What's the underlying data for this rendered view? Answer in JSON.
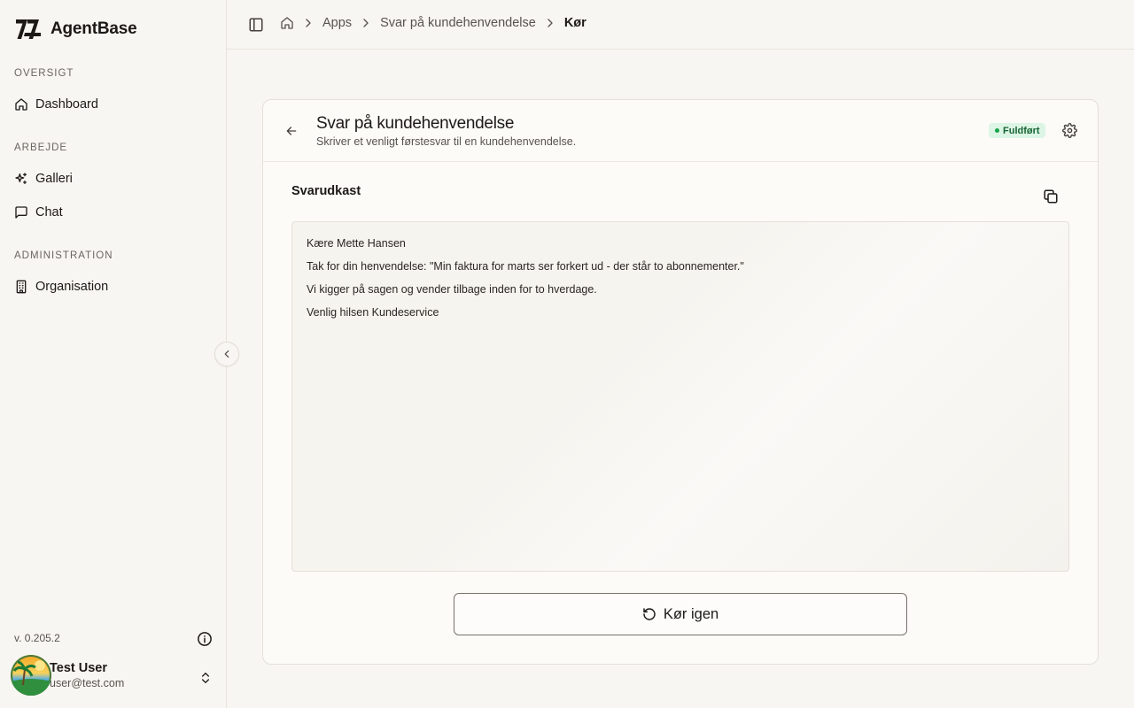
{
  "app": {
    "name": "AgentBase"
  },
  "sidebar": {
    "sections": [
      {
        "label": "OVERSIGT",
        "items": [
          {
            "label": "Dashboard",
            "icon": "home-icon"
          }
        ]
      },
      {
        "label": "ARBEJDE",
        "items": [
          {
            "label": "Galleri",
            "icon": "sparkles-icon"
          },
          {
            "label": "Chat",
            "icon": "message-square-icon"
          }
        ]
      },
      {
        "label": "ADMINISTRATION",
        "items": [
          {
            "label": "Organisation",
            "icon": "building-icon"
          }
        ]
      }
    ],
    "version": "v. 0.205.2",
    "user": {
      "name": "Test User",
      "email": "user@test.com"
    }
  },
  "breadcrumb": {
    "items": [
      "Apps",
      "Svar på kundehenvendelse"
    ],
    "current": "Kør"
  },
  "card": {
    "title": "Svar på kundehenvendelse",
    "subtitle": "Skriver et venligt førstesvar til en kundehenvendelse.",
    "status": "Fuldført",
    "section_title": "Svarudkast",
    "output_lines": [
      "Kære Mette Hansen",
      "Tak for din henvendelse: \"Min faktura for marts ser forkert ud - der står to abonnementer.\"",
      "Vi kigger på sagen og vender tilbage inden for to hverdage.",
      "Venlig hilsen Kundeservice"
    ],
    "run_again_label": "Kør igen"
  },
  "colors": {
    "status_bg": "#dcf5e4",
    "status_text": "#166534",
    "status_dot": "#16a34a"
  }
}
